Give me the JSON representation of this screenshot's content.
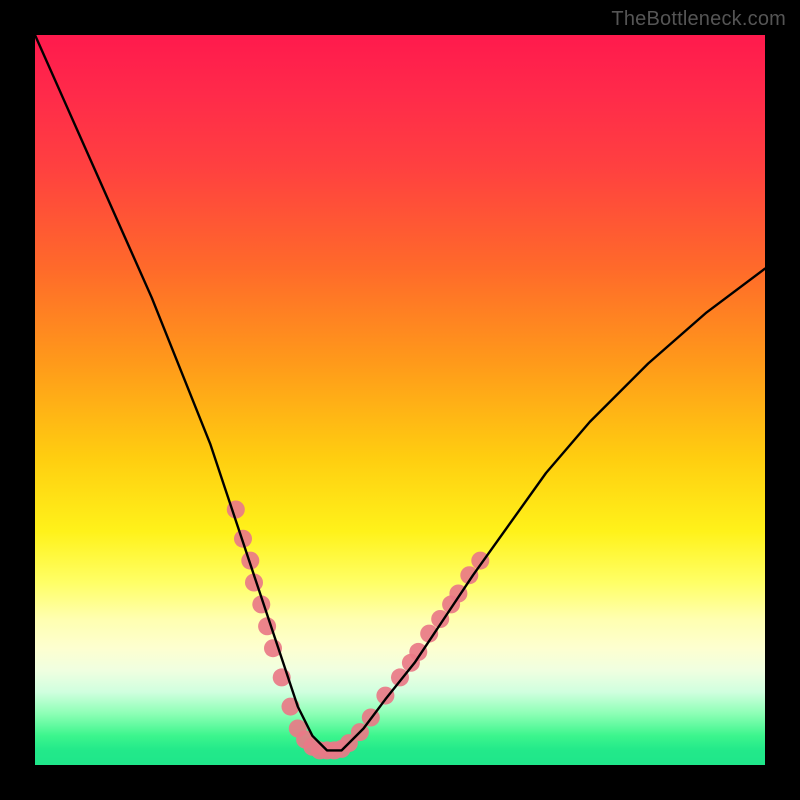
{
  "attribution": "TheBottleneck.com",
  "chart_data": {
    "type": "line",
    "title": "",
    "xlabel": "",
    "ylabel": "",
    "xlim": [
      0,
      100
    ],
    "ylim": [
      0,
      100
    ],
    "grid": false,
    "series": [
      {
        "name": "bottleneck-curve",
        "color": "#000000",
        "x": [
          0,
          4,
          8,
          12,
          16,
          20,
          22,
          24,
          26,
          28,
          30,
          32,
          33,
          34,
          35,
          36,
          37,
          38,
          39,
          40,
          41,
          42,
          43,
          45,
          48,
          52,
          56,
          60,
          65,
          70,
          76,
          84,
          92,
          100
        ],
        "y": [
          100,
          91,
          82,
          73,
          64,
          54,
          49,
          44,
          38,
          32,
          26,
          20,
          17,
          14,
          11,
          8,
          6,
          4,
          3,
          2,
          2,
          2,
          3,
          5,
          9,
          14,
          20,
          26,
          33,
          40,
          47,
          55,
          62,
          68
        ]
      }
    ],
    "markers": {
      "comment": "Pink dot clusters on the left and right flanks of the V",
      "color": "#e97a87",
      "radius_px": 9,
      "points": [
        {
          "x": 27.5,
          "y": 35
        },
        {
          "x": 28.5,
          "y": 31
        },
        {
          "x": 29.5,
          "y": 28
        },
        {
          "x": 30.0,
          "y": 25
        },
        {
          "x": 31.0,
          "y": 22
        },
        {
          "x": 31.8,
          "y": 19
        },
        {
          "x": 32.6,
          "y": 16
        },
        {
          "x": 33.8,
          "y": 12
        },
        {
          "x": 35.0,
          "y": 8
        },
        {
          "x": 36.0,
          "y": 5
        },
        {
          "x": 37.0,
          "y": 3.5
        },
        {
          "x": 38.0,
          "y": 2.5
        },
        {
          "x": 39.0,
          "y": 2.0
        },
        {
          "x": 40.0,
          "y": 2.0
        },
        {
          "x": 41.0,
          "y": 2.0
        },
        {
          "x": 42.0,
          "y": 2.2
        },
        {
          "x": 43.0,
          "y": 3.0
        },
        {
          "x": 44.5,
          "y": 4.5
        },
        {
          "x": 46.0,
          "y": 6.5
        },
        {
          "x": 48.0,
          "y": 9.5
        },
        {
          "x": 50.0,
          "y": 12
        },
        {
          "x": 51.5,
          "y": 14
        },
        {
          "x": 52.5,
          "y": 15.5
        },
        {
          "x": 54.0,
          "y": 18
        },
        {
          "x": 55.5,
          "y": 20
        },
        {
          "x": 57.0,
          "y": 22
        },
        {
          "x": 58.0,
          "y": 23.5
        },
        {
          "x": 59.5,
          "y": 26
        },
        {
          "x": 61.0,
          "y": 28
        }
      ]
    }
  }
}
